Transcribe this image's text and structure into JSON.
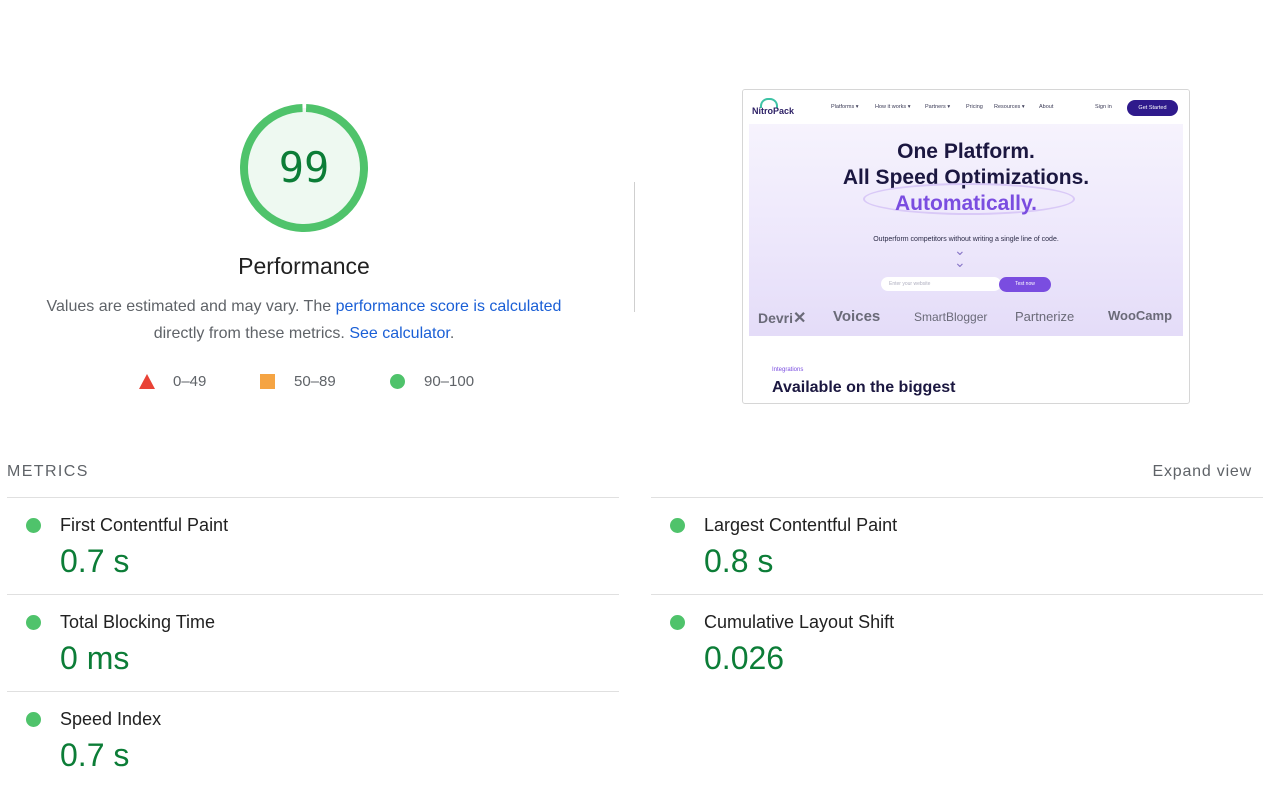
{
  "gauge": {
    "score": "99",
    "score_value": 99,
    "title": "Performance",
    "color": "#0c7d37",
    "ring_color": "#4fc36b"
  },
  "description": {
    "text1": "Values are estimated and may vary. The ",
    "link1": "performance score is calculated",
    "text2": "directly from these metrics. ",
    "link2": "See calculator",
    "text3": "."
  },
  "legend": [
    {
      "icon": "triangle-icon",
      "label": "0–49",
      "color": "#e94236"
    },
    {
      "icon": "square-icon",
      "label": "50–89",
      "color": "#f5a443"
    },
    {
      "icon": "circle-icon",
      "label": "90–100",
      "color": "#4fc36b"
    }
  ],
  "screenshot": {
    "logo": "NitroPack",
    "nav": [
      "Platforms ▾",
      "How it works ▾",
      "Partners ▾",
      "Pricing",
      "Resources ▾",
      "About"
    ],
    "signin": "Sign in",
    "cta": "Get Started",
    "headline": [
      "One Platform.",
      "All Speed Optimizations.",
      "Automatically."
    ],
    "subtitle": "Outperform competitors without writing a single line of code.",
    "input_placeholder": "Enter your website",
    "test_button": "Test now",
    "brands": [
      "Devri",
      "Voices",
      "SmartBlogger",
      "Partnerize",
      "WooCamp"
    ],
    "integrations_label": "Integrations",
    "integrations_title": "Available on the biggest"
  },
  "metrics": {
    "header": "METRICS",
    "expand": "Expand view",
    "items": [
      {
        "name": "first-contentful-paint",
        "title": "First Contentful Paint",
        "value": "0.7 s"
      },
      {
        "name": "largest-contentful-paint",
        "title": "Largest Contentful Paint",
        "value": "0.8 s"
      },
      {
        "name": "total-blocking-time",
        "title": "Total Blocking Time",
        "value": "0 ms"
      },
      {
        "name": "cumulative-layout-shift",
        "title": "Cumulative Layout Shift",
        "value": "0.026"
      },
      {
        "name": "speed-index",
        "title": "Speed Index",
        "value": "0.7 s"
      }
    ]
  }
}
